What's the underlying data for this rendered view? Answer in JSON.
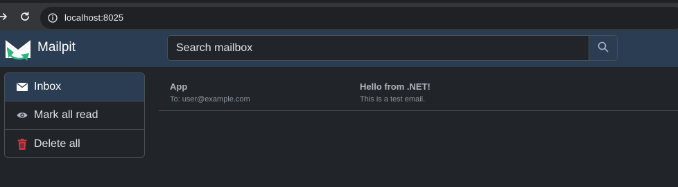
{
  "browser": {
    "url": "localhost:8025"
  },
  "header": {
    "brand": "Mailpit",
    "search_placeholder": "Search mailbox"
  },
  "sidebar": {
    "items": [
      {
        "label": "Inbox",
        "icon": "envelope-icon",
        "active": true
      },
      {
        "label": "Mark all read",
        "icon": "eye-icon",
        "active": false
      },
      {
        "label": "Delete all",
        "icon": "trash-icon",
        "active": false
      }
    ]
  },
  "messages": [
    {
      "from": "App",
      "to": "To: user@example.com",
      "subject": "Hello from .NET!",
      "snippet": "This is a test email."
    }
  ],
  "colors": {
    "header_bg": "#2b3d52",
    "page_bg": "#212529",
    "trash_red": "#dc3545",
    "logo_green": "#2fb47c"
  }
}
